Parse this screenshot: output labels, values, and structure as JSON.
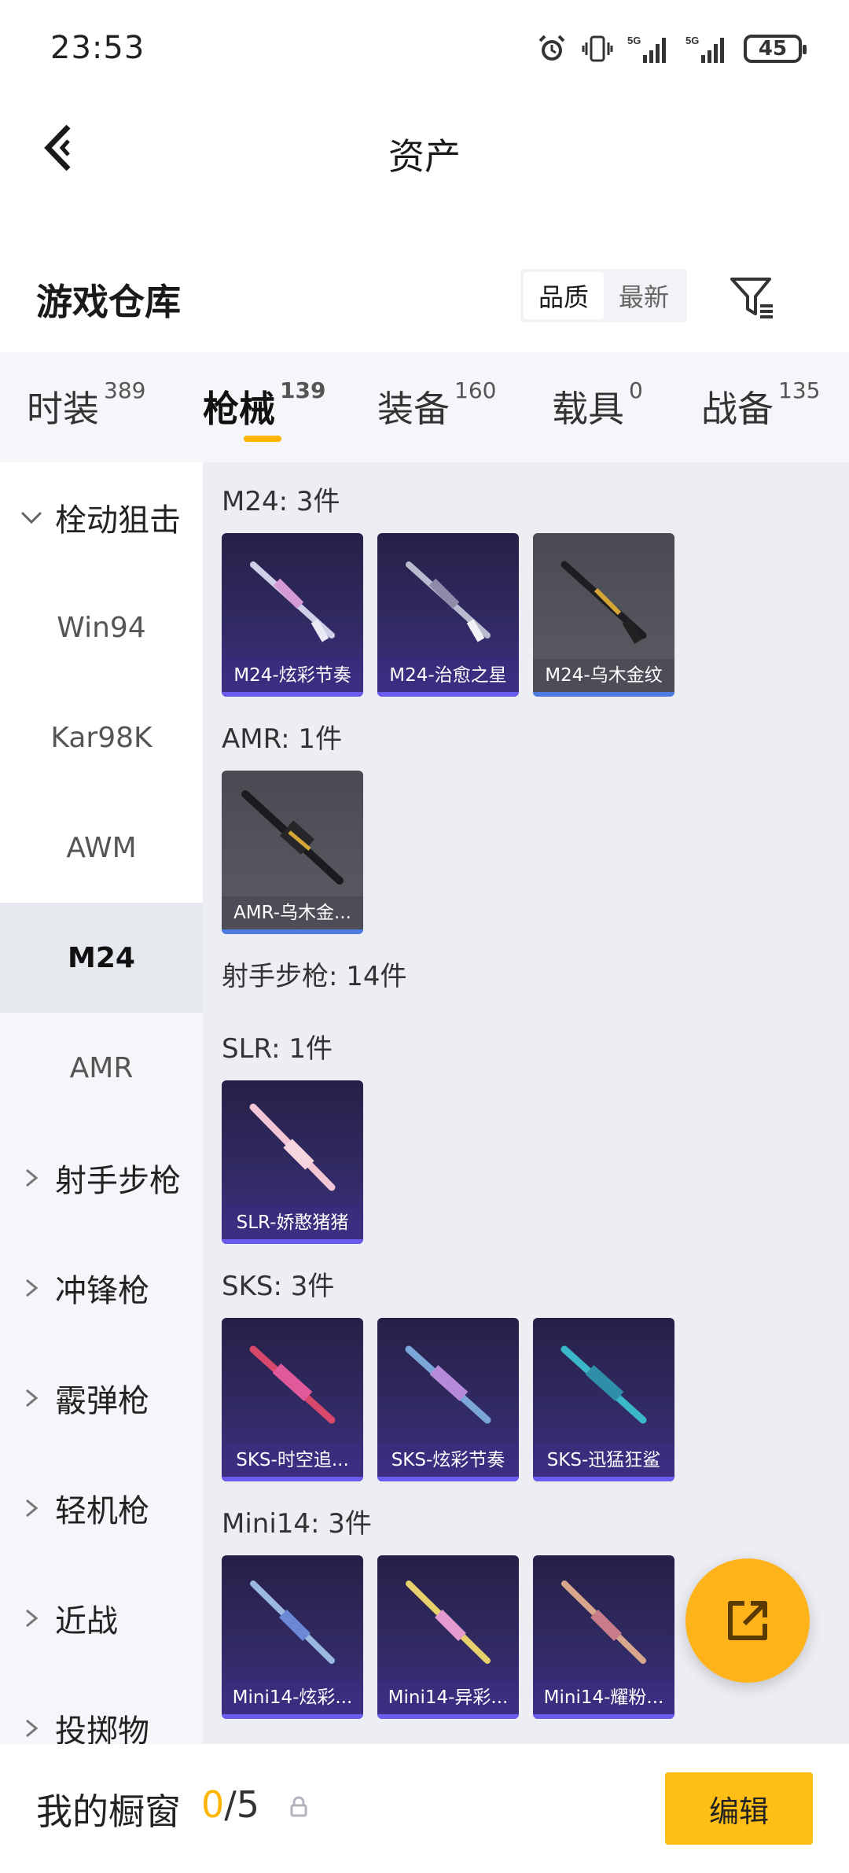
{
  "status_bar": {
    "time": "23:53",
    "battery": "45",
    "signal1": "5G",
    "signal2": "5G"
  },
  "header": {
    "title": "资产"
  },
  "warehouse": {
    "title": "游戏仓库",
    "sort_options": [
      "品质",
      "最新"
    ],
    "sort_active": "品质"
  },
  "tabs": [
    {
      "label": "时装",
      "count": "389"
    },
    {
      "label": "枪械",
      "count": "139"
    },
    {
      "label": "装备",
      "count": "160"
    },
    {
      "label": "载具",
      "count": "0"
    },
    {
      "label": "战备",
      "count": "135"
    }
  ],
  "active_tab": "枪械",
  "sidebar": {
    "groups": [
      {
        "label": "栓动狙击",
        "expanded": true,
        "children": [
          "Win94",
          "Kar98K",
          "AWM",
          "M24",
          "AMR"
        ],
        "selected": "M24"
      },
      {
        "label": "射手步枪",
        "expanded": false
      },
      {
        "label": "冲锋枪",
        "expanded": false
      },
      {
        "label": "霰弹枪",
        "expanded": false
      },
      {
        "label": "轻机枪",
        "expanded": false
      },
      {
        "label": "近战",
        "expanded": false
      },
      {
        "label": "投掷物",
        "expanded": false
      }
    ]
  },
  "content": {
    "sections": [
      {
        "label": "M24: 3件",
        "items": [
          "M24-炫彩节奏",
          "M24-治愈之星",
          "M24-乌木金纹"
        ]
      },
      {
        "label": "AMR: 1件",
        "items": [
          "AMR-乌木金..."
        ]
      },
      {
        "label": "射手步枪: 14件",
        "items": []
      },
      {
        "label": "SLR: 1件",
        "items": [
          "SLR-娇憨猪猪"
        ]
      },
      {
        "label": "SKS: 3件",
        "items": [
          "SKS-时空追...",
          "SKS-炫彩节奏",
          "SKS-迅猛狂鲨"
        ]
      },
      {
        "label": "Mini14: 3件",
        "items": [
          "Mini14-炫彩...",
          "Mini14-异彩...",
          "Mini14-耀粉..."
        ]
      }
    ]
  },
  "bottom": {
    "showcase_label": "我的橱窗",
    "showcase_current": "0",
    "showcase_total": "/5",
    "edit_label": "编辑"
  },
  "colors": {
    "accent": "#ffb400",
    "card_purple": "#312a63",
    "card_gray": "#55555e"
  },
  "icons": [
    "back-arrow-icon",
    "filter-icon",
    "chevron-down-icon",
    "chevron-right-icon",
    "share-icon",
    "lock-icon",
    "alarm-icon",
    "vibrate-icon"
  ]
}
